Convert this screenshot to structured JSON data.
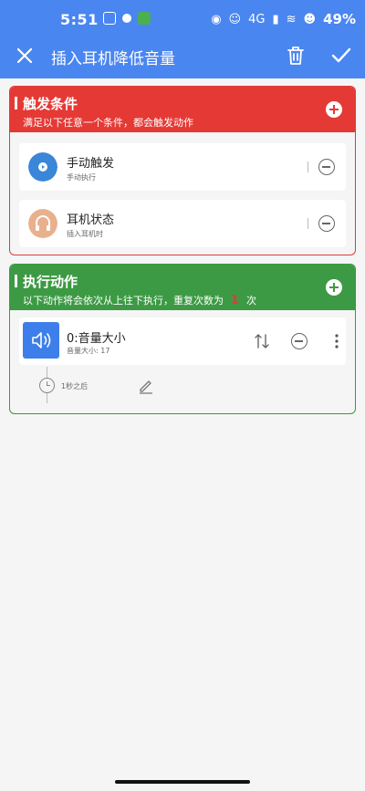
{
  "status_bar": {
    "time": "5:51",
    "network": "4G",
    "battery": "49%"
  },
  "toolbar": {
    "title": "插入耳机降低音量"
  },
  "trigger_section": {
    "title": "触发条件",
    "subtitle": "满足以下任意一个条件，都会触发动作",
    "items": [
      {
        "title": "手动触发",
        "subtitle": "手动执行",
        "icon": "play-icon",
        "color": "#3a86d8"
      },
      {
        "title": "耳机状态",
        "subtitle": "插入耳机时",
        "icon": "headphones-icon",
        "color": "#e8b08c"
      }
    ]
  },
  "action_section": {
    "title": "执行动作",
    "subtitle_before": "以下动作将会依次从上往下执行，重复次数为",
    "repeat_count": "1",
    "subtitle_after": "次",
    "items": [
      {
        "title": "0:音量大小",
        "subtitle": "音量大小: 17",
        "icon": "volume-icon",
        "color": "#3d7fea"
      }
    ],
    "delay_label": "1秒之后"
  }
}
